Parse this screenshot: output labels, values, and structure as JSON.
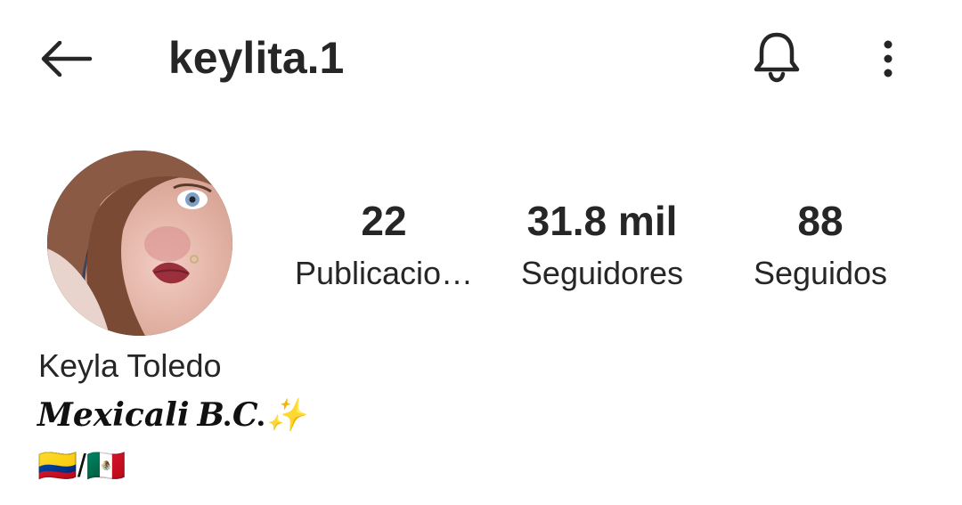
{
  "header": {
    "username": "keylita.1",
    "back_icon": "arrow-left-icon",
    "bell_icon": "bell-icon",
    "more_icon": "more-vertical-icon"
  },
  "profile": {
    "full_name": "Keyla Toledo",
    "bio_line1": "𝑴𝒆𝒙𝒊𝒄𝒂𝒍𝒊 𝑩.𝑪.✨",
    "bio_line2": "🇨🇴/🇲🇽"
  },
  "stats": {
    "posts_count": "22",
    "posts_label": "Publicacio…",
    "followers_count": "31.8 mil",
    "followers_label": "Seguidores",
    "following_count": "88",
    "following_label": "Seguidos"
  },
  "colors": {
    "text": "#262626",
    "background": "#ffffff"
  }
}
